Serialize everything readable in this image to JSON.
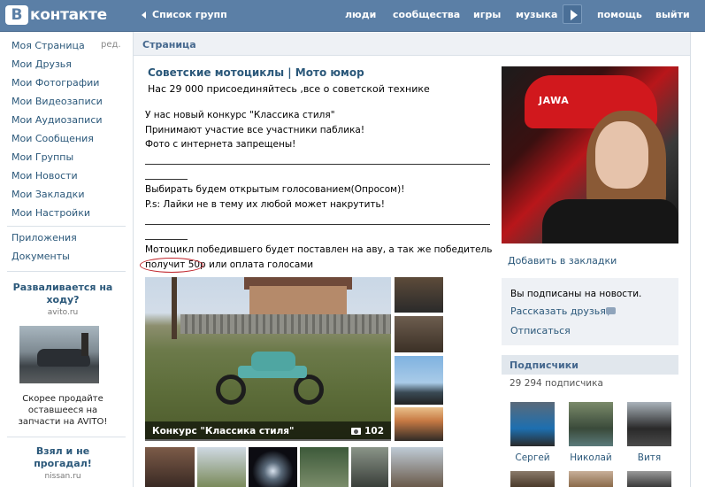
{
  "header": {
    "logo_letter": "В",
    "logo_text": "контакте",
    "back_label": "Список групп",
    "nav": [
      "люди",
      "сообщества",
      "игры",
      "музыка",
      "помощь",
      "выйти"
    ]
  },
  "sidebar": {
    "items": [
      "Моя Страница",
      "Мои Друзья",
      "Мои Фотографии",
      "Мои Видеозаписи",
      "Мои Аудиозаписи",
      "Мои Сообщения",
      "Мои Группы",
      "Мои Новости",
      "Мои Закладки",
      "Мои Настройки"
    ],
    "edit_label": "ред.",
    "extra": [
      "Приложения",
      "Документы"
    ],
    "ad1": {
      "title": "Разваливается на ходу?",
      "domain": "avito.ru",
      "text": "Скорее продайте оставшееся на запчасти на AVITO!"
    },
    "ad2": {
      "title": "Взял и не прогадал!",
      "domain": "nissan.ru"
    }
  },
  "main": {
    "heading": "Страница",
    "group_title": "Советские мотоциклы | Мото юмор",
    "group_status": "Нас 29 000 присоединяйтесь ,все о советской технике",
    "post_lines": [
      "У нас новый конкурс \"Классика стиля\"",
      "Принимают участие все участники паблика!",
      "Фото с интернета запрещены!",
      "Выбирать будем открытым голосованием(Опросом)!",
      "P.s: Лайки не в тему их любой может накрутить!",
      "Мотоцикл победившего будет поставлен на аву, а так же победитель",
      "получит 50р или оплата голосами"
    ],
    "album_caption": "Конкурс \"Классика стиля\"",
    "album_count": "102"
  },
  "right": {
    "add_bookmark": "Добавить в закладки",
    "subscribed_text": "Вы подписаны на новости.",
    "tell_friends": "Рассказать друзьям",
    "unsubscribe": "Отписаться",
    "subscribers_heading": "Подписчики",
    "subscribers_count": "29 294 подписчика",
    "friends": [
      "Сергей",
      "Николай",
      "Витя"
    ]
  },
  "colors": {
    "header_bg": "#5b7fa6",
    "link": "#2b587a",
    "highlight_circle": "#c0262d"
  }
}
